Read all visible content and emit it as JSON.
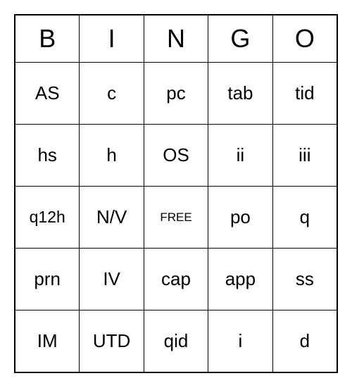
{
  "header": [
    "B",
    "I",
    "N",
    "G",
    "O"
  ],
  "grid": [
    [
      "AS",
      "c",
      "pc",
      "tab",
      "tid"
    ],
    [
      "hs",
      "h",
      "OS",
      "ii",
      "iii"
    ],
    [
      "q12h",
      "N/V",
      "FREE",
      "po",
      "q"
    ],
    [
      "prn",
      "IV",
      "cap",
      "app",
      "ss"
    ],
    [
      "IM",
      "UTD",
      "qid",
      "i",
      "d"
    ]
  ],
  "free_label": "FREE"
}
